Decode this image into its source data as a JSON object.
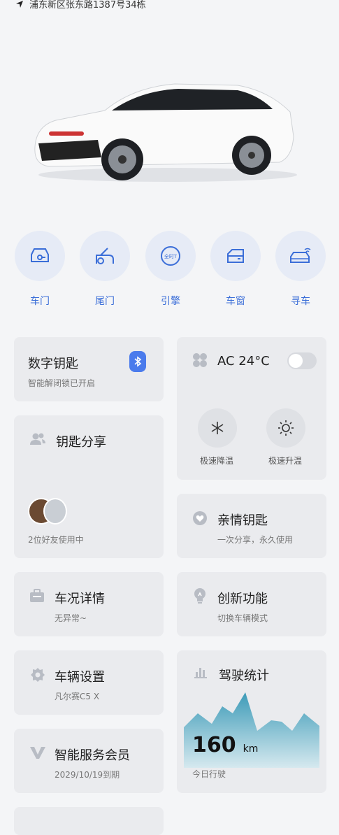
{
  "location": {
    "address": "浦东新区张东路1387号34栋"
  },
  "controls": [
    {
      "label": "车门",
      "icon": "car-door-key-icon"
    },
    {
      "label": "尾门",
      "icon": "tailgate-icon"
    },
    {
      "label": "引擎",
      "icon": "engine-badge-icon",
      "badge": "全时T"
    },
    {
      "label": "车窗",
      "icon": "car-window-icon"
    },
    {
      "label": "寻车",
      "icon": "find-car-icon"
    }
  ],
  "digital_key": {
    "title": "数字钥匙",
    "status": "智能解闭锁已开启",
    "icon": "bluetooth-icon"
  },
  "ac": {
    "label": "AC 24°C",
    "enabled": false,
    "cool": {
      "label": "极速降温",
      "icon": "snowflake-icon"
    },
    "heat": {
      "label": "极速升温",
      "icon": "sun-icon"
    }
  },
  "key_share": {
    "title": "钥匙分享",
    "status": "2位好友使用中",
    "icon": "users-icon"
  },
  "family_key": {
    "title": "亲情钥匙",
    "subtitle": "一次分享，永久使用",
    "icon": "heart-icon"
  },
  "condition": {
    "title": "车况详情",
    "subtitle": "无异常~",
    "icon": "briefcase-icon"
  },
  "innovation": {
    "title": "创新功能",
    "subtitle": "切换车辆模式",
    "icon": "lightbulb-icon"
  },
  "settings": {
    "title": "车辆设置",
    "subtitle": "凡尔赛C5 X",
    "icon": "gear-icon"
  },
  "driving": {
    "title": "驾驶统计",
    "value": "160",
    "unit": "km",
    "caption": "今日行驶",
    "icon": "bar-chart-icon"
  },
  "membership": {
    "title": "智能服务会员",
    "expiry": "2029/10/19到期",
    "icon": "v-logo-icon"
  }
}
